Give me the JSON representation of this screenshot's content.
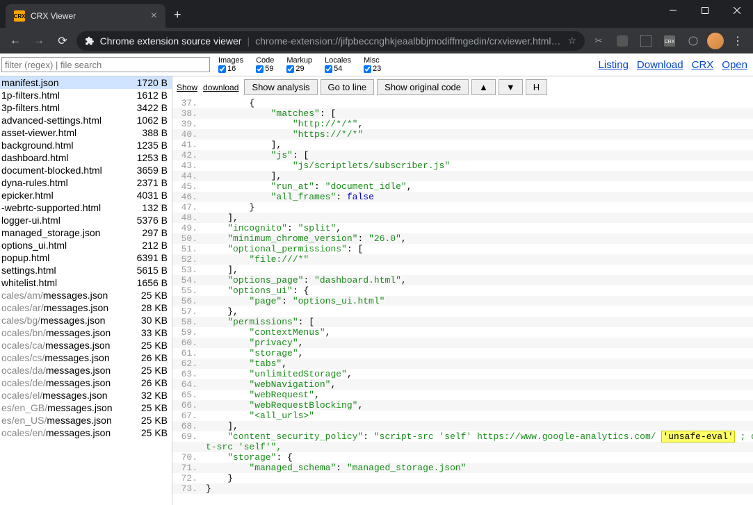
{
  "window": {
    "tab_title": "CRX Viewer",
    "tab_icon": "CRX",
    "omnibox_title": "Chrome extension source viewer",
    "omnibox_url": "chrome-extension://jifpbeccnghkjeaalbbjmodiffmgedin/crxviewer.html?cr..."
  },
  "search": {
    "placeholder": "filter (regex) | file search"
  },
  "counts": {
    "images": {
      "label": "Images",
      "val": "16"
    },
    "code": {
      "label": "Code",
      "val": "59"
    },
    "markup": {
      "label": "Markup",
      "val": "29"
    },
    "locales": {
      "label": "Locales",
      "val": "54"
    },
    "misc": {
      "label": "Misc",
      "val": "23"
    }
  },
  "top_links": {
    "listing": "Listing",
    "download": "Download",
    "crx": "CRX",
    "open": "Open"
  },
  "files": [
    {
      "name": "manifest.json",
      "size": "1720 B",
      "selected": true
    },
    {
      "name": "1p-filters.html",
      "size": "1612 B"
    },
    {
      "name": "3p-filters.html",
      "size": "3422 B"
    },
    {
      "name": "advanced-settings.html",
      "size": "1062 B"
    },
    {
      "name": "asset-viewer.html",
      "size": "388 B"
    },
    {
      "name": "background.html",
      "size": "1235 B"
    },
    {
      "name": "dashboard.html",
      "size": "1253 B"
    },
    {
      "name": "document-blocked.html",
      "size": "3659 B"
    },
    {
      "name": "dyna-rules.html",
      "size": "2371 B"
    },
    {
      "name": "epicker.html",
      "size": "4031 B"
    },
    {
      "name": "-webrtc-supported.html",
      "size": "132 B"
    },
    {
      "name": "logger-ui.html",
      "size": "5376 B"
    },
    {
      "name": "managed_storage.json",
      "size": "297 B"
    },
    {
      "name": "options_ui.html",
      "size": "212 B"
    },
    {
      "name": "popup.html",
      "size": "6391 B"
    },
    {
      "name": "settings.html",
      "size": "5615 B"
    },
    {
      "name": "whitelist.html",
      "size": "1656 B"
    },
    {
      "prefix": "cales/am/",
      "name": "messages.json",
      "size": "25 KB"
    },
    {
      "prefix": "ocales/ar/",
      "name": "messages.json",
      "size": "28 KB"
    },
    {
      "prefix": "cales/bg/",
      "name": "messages.json",
      "size": "30 KB"
    },
    {
      "prefix": "ocales/bn/",
      "name": "messages.json",
      "size": "33 KB"
    },
    {
      "prefix": "ocales/ca/",
      "name": "messages.json",
      "size": "25 KB"
    },
    {
      "prefix": "ocales/cs/",
      "name": "messages.json",
      "size": "26 KB"
    },
    {
      "prefix": "ocales/da/",
      "name": "messages.json",
      "size": "25 KB"
    },
    {
      "prefix": "ocales/de/",
      "name": "messages.json",
      "size": "26 KB"
    },
    {
      "prefix": "ocales/el/",
      "name": "messages.json",
      "size": "32 KB"
    },
    {
      "prefix": "es/en_GB/",
      "name": "messages.json",
      "size": "25 KB"
    },
    {
      "prefix": "es/en_US/",
      "name": "messages.json",
      "size": "25 KB"
    },
    {
      "prefix": "ocales/en/",
      "name": "messages.json",
      "size": "25 KB"
    }
  ],
  "toolbar": {
    "show": "Show",
    "download": "download",
    "show_analysis": "Show analysis",
    "go_to_line": "Go to line",
    "show_original": "Show original code",
    "up": "▲",
    "down": "▼",
    "h": "H"
  },
  "code": [
    {
      "n": 37,
      "indent": 8,
      "tokens": [
        {
          "t": "{",
          "c": "punct"
        }
      ]
    },
    {
      "n": 38,
      "indent": 12,
      "tokens": [
        {
          "t": "\"matches\"",
          "c": "key"
        },
        {
          "t": ": [",
          "c": "punct"
        }
      ]
    },
    {
      "n": 39,
      "indent": 16,
      "tokens": [
        {
          "t": "\"http://*/*\"",
          "c": "str"
        },
        {
          "t": ",",
          "c": "punct"
        }
      ]
    },
    {
      "n": 40,
      "indent": 16,
      "tokens": [
        {
          "t": "\"https://*/*\"",
          "c": "str"
        }
      ]
    },
    {
      "n": 41,
      "indent": 12,
      "tokens": [
        {
          "t": "],",
          "c": "punct"
        }
      ]
    },
    {
      "n": 42,
      "indent": 12,
      "tokens": [
        {
          "t": "\"js\"",
          "c": "key"
        },
        {
          "t": ": [",
          "c": "punct"
        }
      ]
    },
    {
      "n": 43,
      "indent": 16,
      "tokens": [
        {
          "t": "\"js/scriptlets/subscriber.js\"",
          "c": "str"
        }
      ]
    },
    {
      "n": 44,
      "indent": 12,
      "tokens": [
        {
          "t": "],",
          "c": "punct"
        }
      ]
    },
    {
      "n": 45,
      "indent": 12,
      "tokens": [
        {
          "t": "\"run_at\"",
          "c": "key"
        },
        {
          "t": ": ",
          "c": "punct"
        },
        {
          "t": "\"document_idle\"",
          "c": "str"
        },
        {
          "t": ",",
          "c": "punct"
        }
      ]
    },
    {
      "n": 46,
      "indent": 12,
      "tokens": [
        {
          "t": "\"all_frames\"",
          "c": "key"
        },
        {
          "t": ": ",
          "c": "punct"
        },
        {
          "t": "false",
          "c": "kw"
        }
      ]
    },
    {
      "n": 47,
      "indent": 8,
      "tokens": [
        {
          "t": "}",
          "c": "punct"
        }
      ]
    },
    {
      "n": 48,
      "indent": 4,
      "tokens": [
        {
          "t": "],",
          "c": "punct"
        }
      ]
    },
    {
      "n": 49,
      "indent": 4,
      "tokens": [
        {
          "t": "\"incognito\"",
          "c": "key"
        },
        {
          "t": ": ",
          "c": "punct"
        },
        {
          "t": "\"split\"",
          "c": "str"
        },
        {
          "t": ",",
          "c": "punct"
        }
      ]
    },
    {
      "n": 50,
      "indent": 4,
      "tokens": [
        {
          "t": "\"minimum_chrome_version\"",
          "c": "key"
        },
        {
          "t": ": ",
          "c": "punct"
        },
        {
          "t": "\"26.0\"",
          "c": "str"
        },
        {
          "t": ",",
          "c": "punct"
        }
      ]
    },
    {
      "n": 51,
      "indent": 4,
      "tokens": [
        {
          "t": "\"optional_permissions\"",
          "c": "key"
        },
        {
          "t": ": [",
          "c": "punct"
        }
      ]
    },
    {
      "n": 52,
      "indent": 8,
      "tokens": [
        {
          "t": "\"file:///*\"",
          "c": "str"
        }
      ]
    },
    {
      "n": 53,
      "indent": 4,
      "tokens": [
        {
          "t": "],",
          "c": "punct"
        }
      ]
    },
    {
      "n": 54,
      "indent": 4,
      "tokens": [
        {
          "t": "\"options_page\"",
          "c": "key"
        },
        {
          "t": ": ",
          "c": "punct"
        },
        {
          "t": "\"dashboard.html\"",
          "c": "str"
        },
        {
          "t": ",",
          "c": "punct"
        }
      ]
    },
    {
      "n": 55,
      "indent": 4,
      "tokens": [
        {
          "t": "\"options_ui\"",
          "c": "key"
        },
        {
          "t": ": {",
          "c": "punct"
        }
      ]
    },
    {
      "n": 56,
      "indent": 8,
      "tokens": [
        {
          "t": "\"page\"",
          "c": "key"
        },
        {
          "t": ": ",
          "c": "punct"
        },
        {
          "t": "\"options_ui.html\"",
          "c": "str"
        }
      ]
    },
    {
      "n": 57,
      "indent": 4,
      "tokens": [
        {
          "t": "},",
          "c": "punct"
        }
      ]
    },
    {
      "n": 58,
      "indent": 4,
      "tokens": [
        {
          "t": "\"permissions\"",
          "c": "key"
        },
        {
          "t": ": [",
          "c": "punct"
        }
      ]
    },
    {
      "n": 59,
      "indent": 8,
      "tokens": [
        {
          "t": "\"contextMenus\"",
          "c": "str"
        },
        {
          "t": ",",
          "c": "punct"
        }
      ]
    },
    {
      "n": 60,
      "indent": 8,
      "tokens": [
        {
          "t": "\"privacy\"",
          "c": "str"
        },
        {
          "t": ",",
          "c": "punct"
        }
      ]
    },
    {
      "n": 61,
      "indent": 8,
      "tokens": [
        {
          "t": "\"storage\"",
          "c": "str"
        },
        {
          "t": ",",
          "c": "punct"
        }
      ]
    },
    {
      "n": 62,
      "indent": 8,
      "tokens": [
        {
          "t": "\"tabs\"",
          "c": "str"
        },
        {
          "t": ",",
          "c": "punct"
        }
      ]
    },
    {
      "n": 63,
      "indent": 8,
      "tokens": [
        {
          "t": "\"unlimitedStorage\"",
          "c": "str"
        },
        {
          "t": ",",
          "c": "punct"
        }
      ]
    },
    {
      "n": 64,
      "indent": 8,
      "tokens": [
        {
          "t": "\"webNavigation\"",
          "c": "str"
        },
        {
          "t": ",",
          "c": "punct"
        }
      ]
    },
    {
      "n": 65,
      "indent": 8,
      "tokens": [
        {
          "t": "\"webRequest\"",
          "c": "str"
        },
        {
          "t": ",",
          "c": "punct"
        }
      ]
    },
    {
      "n": 66,
      "indent": 8,
      "tokens": [
        {
          "t": "\"webRequestBlocking\"",
          "c": "str"
        },
        {
          "t": ",",
          "c": "punct"
        }
      ]
    },
    {
      "n": 67,
      "indent": 8,
      "tokens": [
        {
          "t": "\"<all_urls>\"",
          "c": "str"
        }
      ]
    },
    {
      "n": 68,
      "indent": 4,
      "tokens": [
        {
          "t": "],",
          "c": "punct"
        }
      ]
    },
    {
      "n": 69,
      "indent": 4,
      "tokens": [
        {
          "t": "\"content_security_policy\"",
          "c": "key"
        },
        {
          "t": ": ",
          "c": "punct"
        },
        {
          "t": "\"script-src 'self' https://www.google-analytics.com/ ",
          "c": "str"
        },
        {
          "t": "'unsafe-eval'",
          "c": "hl"
        },
        {
          "t": " ; objec",
          "c": "str"
        }
      ],
      "wrap": "t-src 'self'\","
    },
    {
      "n": 70,
      "indent": 4,
      "tokens": [
        {
          "t": "\"storage\"",
          "c": "key"
        },
        {
          "t": ": {",
          "c": "punct"
        }
      ]
    },
    {
      "n": 71,
      "indent": 8,
      "tokens": [
        {
          "t": "\"managed_schema\"",
          "c": "key"
        },
        {
          "t": ": ",
          "c": "punct"
        },
        {
          "t": "\"managed_storage.json\"",
          "c": "str"
        }
      ]
    },
    {
      "n": 72,
      "indent": 4,
      "tokens": [
        {
          "t": "}",
          "c": "punct"
        }
      ]
    },
    {
      "n": 73,
      "indent": 0,
      "tokens": [
        {
          "t": "}",
          "c": "punct"
        }
      ]
    }
  ]
}
